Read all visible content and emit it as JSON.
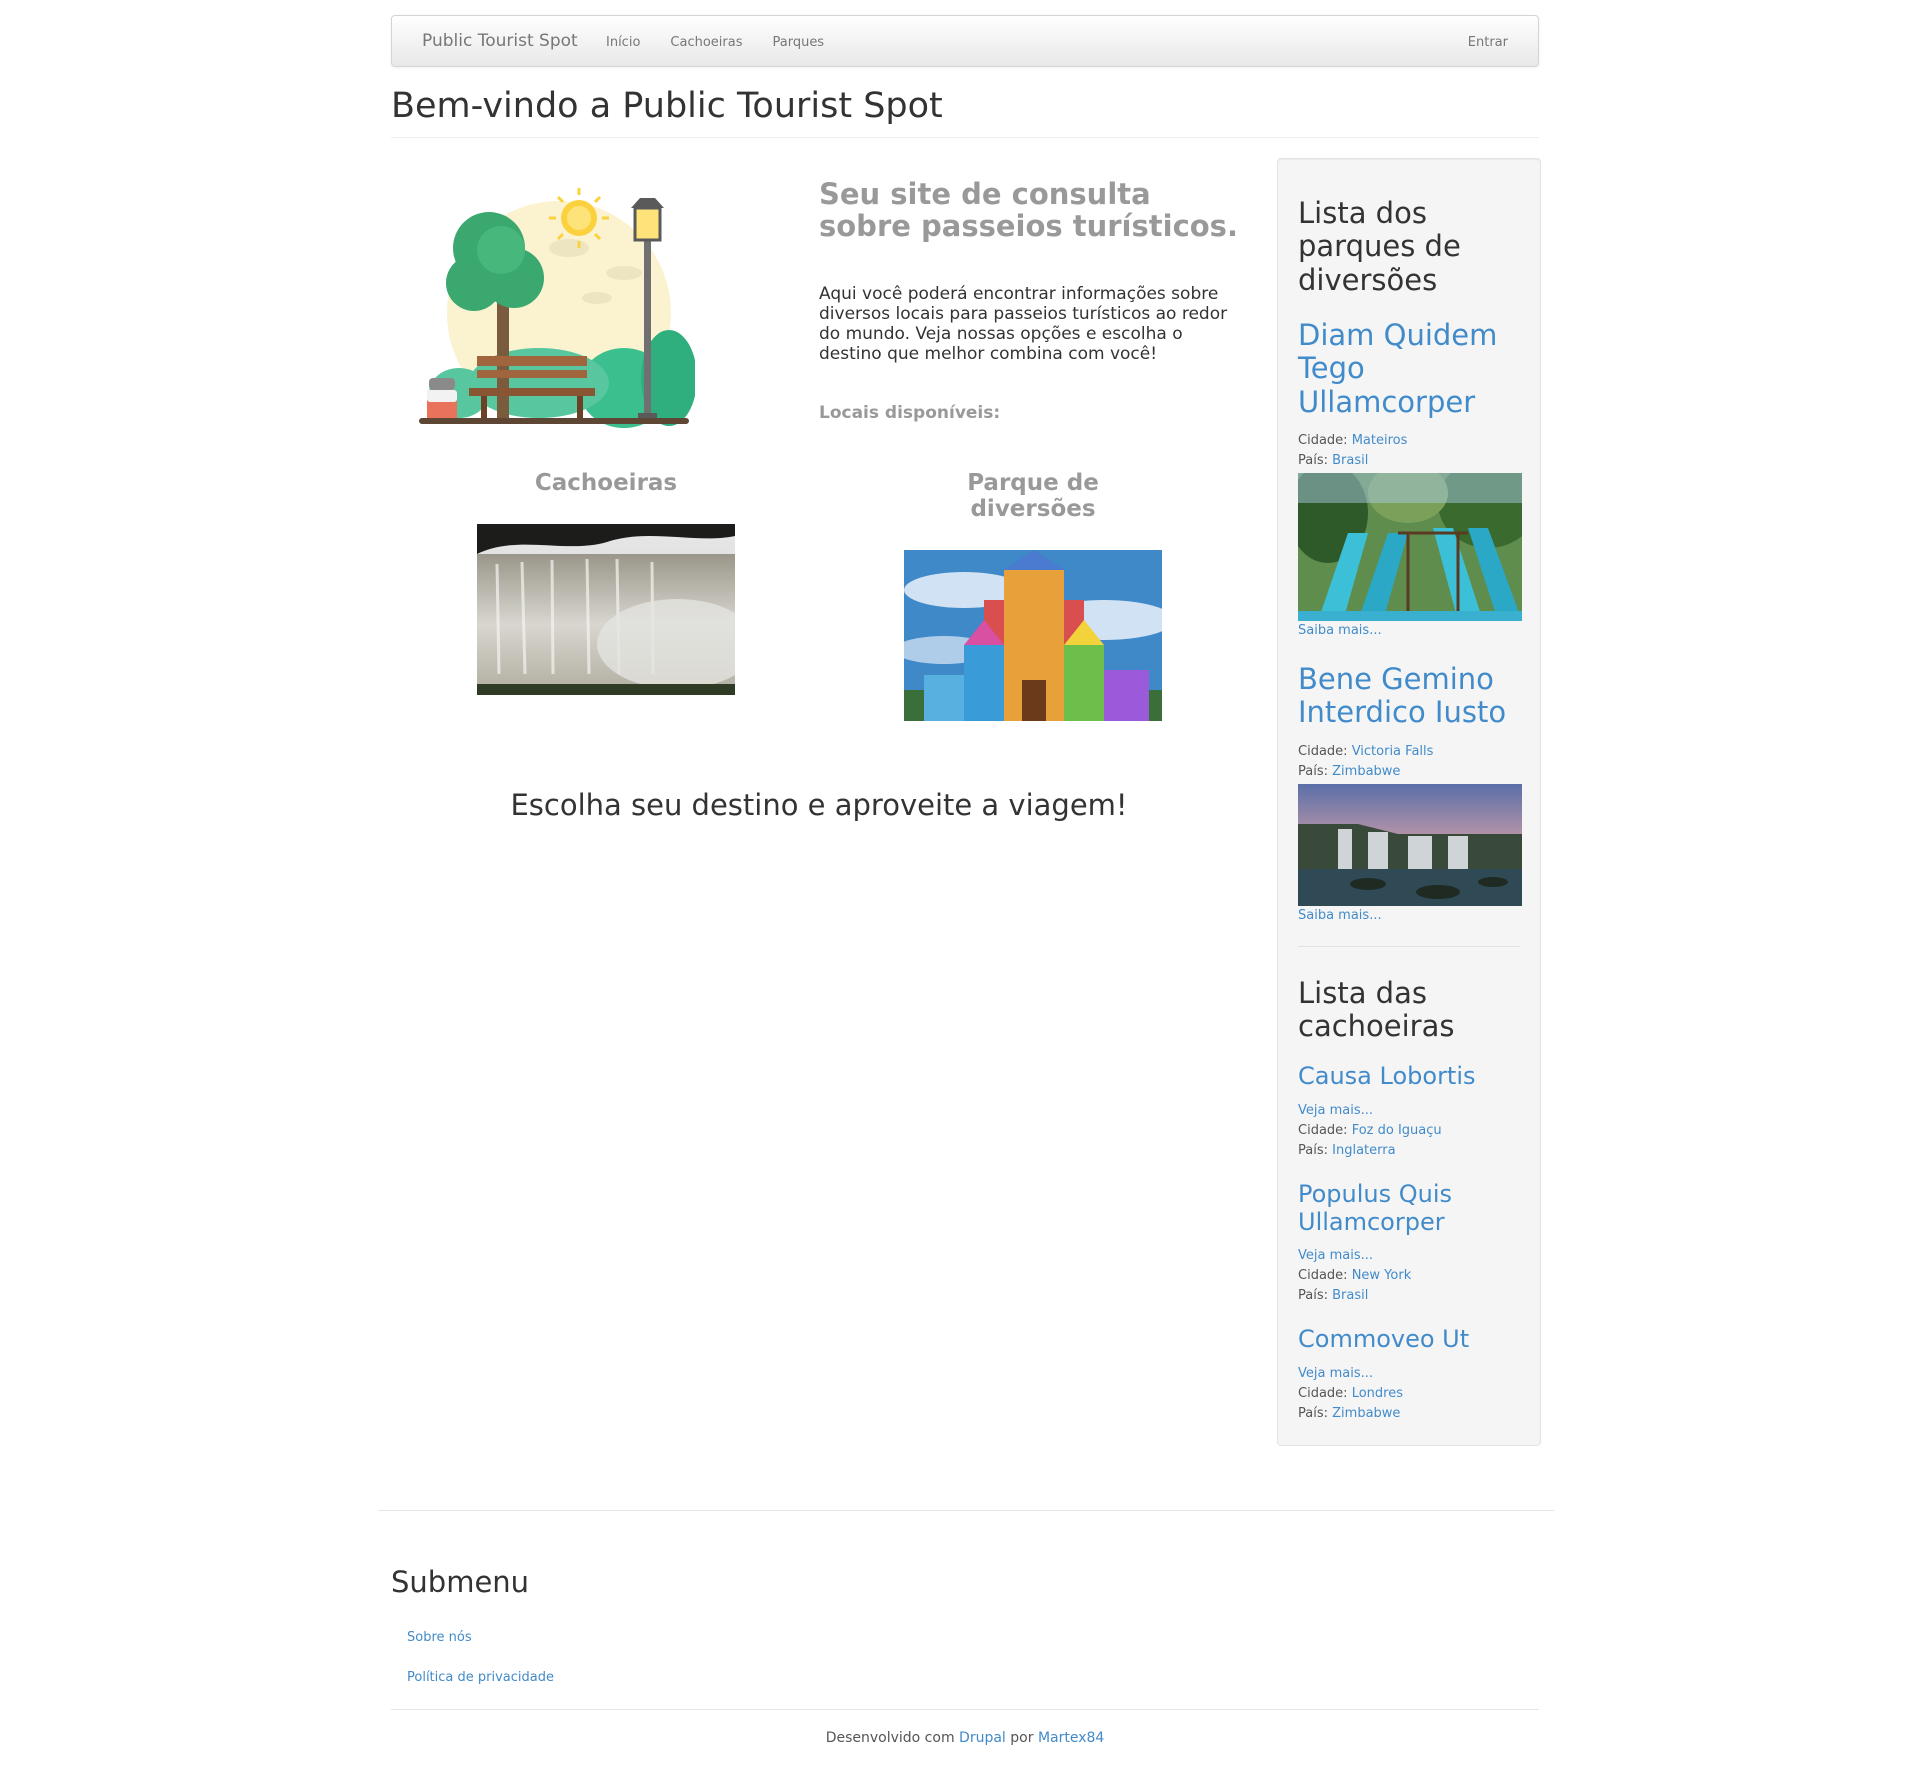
{
  "navbar": {
    "brand": "Public Tourist Spot",
    "items": [
      {
        "label": "Início"
      },
      {
        "label": "Cachoeiras"
      },
      {
        "label": "Parques"
      }
    ],
    "login": "Entrar"
  },
  "page": {
    "title": "Bem-vindo a Public Tourist Spot"
  },
  "intro": {
    "heading": "Seu site de consulta sobre passeios turísticos.",
    "text": "Aqui você poderá encontrar informações sobre diversos locais para passeios turísticos ao redor do mundo. Veja nossas opções e escolha o destino que melhor combina com você!",
    "locais_label": "Locais disponíveis:"
  },
  "cards": [
    {
      "title": "Cachoeiras"
    },
    {
      "title": "Parque de diversões"
    }
  ],
  "tagline": "Escolha seu destino e aproveite a viagem!",
  "sidebar": {
    "parks": {
      "heading": "Lista dos parques de diversões",
      "items": [
        {
          "title": "Diam Quidem Tego Ullamcorper",
          "city_label": "Cidade:",
          "city": "Mateiros",
          "country_label": "País:",
          "country": "Brasil",
          "more": "Saiba mais..."
        },
        {
          "title": "Bene Gemino Interdico Iusto",
          "city_label": "Cidade:",
          "city": "Victoria Falls",
          "country_label": "País:",
          "country": "Zimbabwe",
          "more": "Saiba mais..."
        }
      ]
    },
    "waterfalls": {
      "heading": "Lista das cachoeiras",
      "items": [
        {
          "title": "Causa Lobortis",
          "more": "Veja mais...",
          "city_label": "Cidade:",
          "city": "Foz do Iguaçu",
          "country_label": "País:",
          "country": "Inglaterra"
        },
        {
          "title": "Populus Quis Ullamcorper",
          "more": "Veja mais...",
          "city_label": "Cidade:",
          "city": "New York",
          "country_label": "País:",
          "country": "Brasil"
        },
        {
          "title": "Commoveo Ut",
          "more": "Veja mais...",
          "city_label": "Cidade:",
          "city": "Londres",
          "country_label": "País:",
          "country": "Zimbabwe"
        }
      ]
    }
  },
  "footer": {
    "submenu_title": "Submenu",
    "links": [
      {
        "label": "Sobre nós"
      },
      {
        "label": "Política de privacidade"
      }
    ],
    "credits_prefix": "Desenvolvido com",
    "credits_drupal": "Drupal",
    "credits_por": "por",
    "credits_author": "Martex84"
  }
}
